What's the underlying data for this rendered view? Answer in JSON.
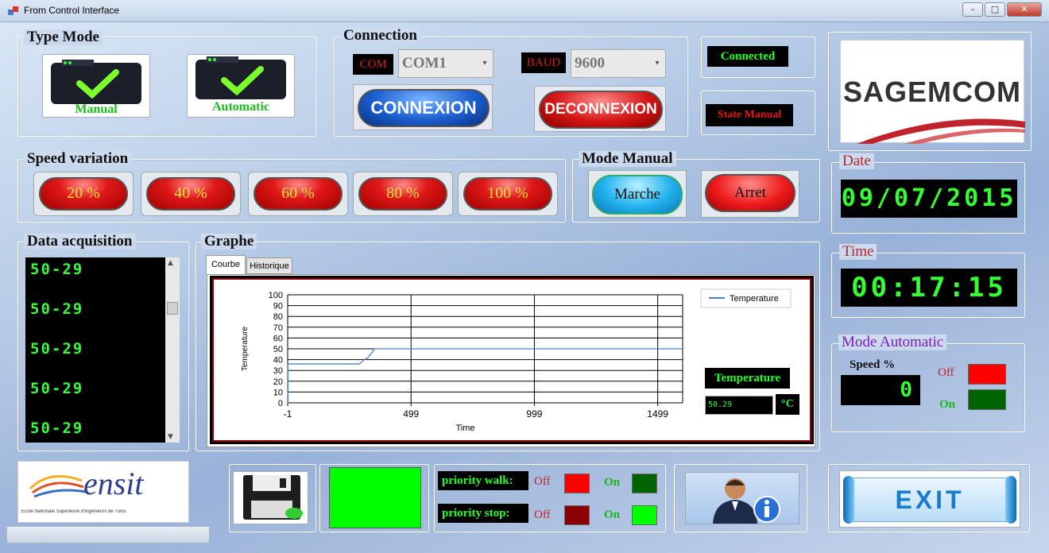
{
  "window": {
    "title": "From Control Interface",
    "min": "–",
    "max": "□",
    "close": "✕"
  },
  "type_mode": {
    "title": "Type Mode",
    "manual_label": "Manual",
    "automatic_label": "Automatic"
  },
  "connection": {
    "title": "Connection",
    "com_label": "COM",
    "com_value": "COM1",
    "baud_label": "BAUD",
    "baud_value": "9600",
    "connect_label": "CONNEXION",
    "disconnect_label": "DECONNEXION"
  },
  "status": {
    "connected": "Connected",
    "state": "State Manual"
  },
  "speed": {
    "title": "Speed variation",
    "buttons": [
      "20 %",
      "40 %",
      "60 %",
      "80 %",
      "100 %"
    ]
  },
  "mode_manual": {
    "title": "Mode Manual",
    "marche": "Marche",
    "arret": "Arret"
  },
  "data_acq": {
    "title": "Data acquisition",
    "rows": [
      "50-29",
      "50-29",
      "50-29",
      "50-29",
      "50-29"
    ]
  },
  "graph": {
    "title": "Graphe",
    "tabs": [
      "Courbe",
      "Historique"
    ],
    "temp_label": "Temperature",
    "temp_value": "50.29",
    "unit": "°C"
  },
  "chart_data": {
    "type": "line",
    "title": "",
    "xlabel": "Time",
    "ylabel": "Temperature",
    "xlim": [
      -1,
      1600
    ],
    "ylim": [
      0,
      100
    ],
    "xticks": [
      "-1",
      "499",
      "999",
      "1499"
    ],
    "yticks": [
      "0",
      "10",
      "20",
      "30",
      "40",
      "50",
      "60",
      "70",
      "80",
      "90",
      "100"
    ],
    "legend": "top-right",
    "grid": true,
    "series": [
      {
        "name": "Temperature",
        "color": "#4a7ec8",
        "x": [
          -1,
          0,
          0,
          290,
          300,
          310,
          325,
          330,
          340,
          350,
          1600
        ],
        "y": [
          0,
          0,
          36,
          36,
          38,
          40,
          42,
          44,
          46,
          50,
          50
        ]
      }
    ]
  },
  "logo": {
    "sagemcom": "SAGEMCOM",
    "ensit": "ensit",
    "ensit_sub": "École Nationale Supérieure d'Ingénieurs de Tunis"
  },
  "date": {
    "title": "Date",
    "value": "09/07/2015"
  },
  "time": {
    "title": "Time",
    "value": "00:17:15"
  },
  "mode_auto": {
    "title": "Mode Automatic",
    "speed_label": "Speed %",
    "speed_value": "0",
    "off": "Off",
    "on": "On"
  },
  "priority": {
    "walk": "priority walk:",
    "stop": "priority stop:",
    "off": "Off",
    "on": "On"
  },
  "exit": {
    "label": "EXIT"
  },
  "colors": {
    "green_box": "#00ff00",
    "off_red": "#ff0000",
    "on_green": "#006400",
    "stop_off": "#8b0000",
    "stop_on": "#00ff00"
  }
}
